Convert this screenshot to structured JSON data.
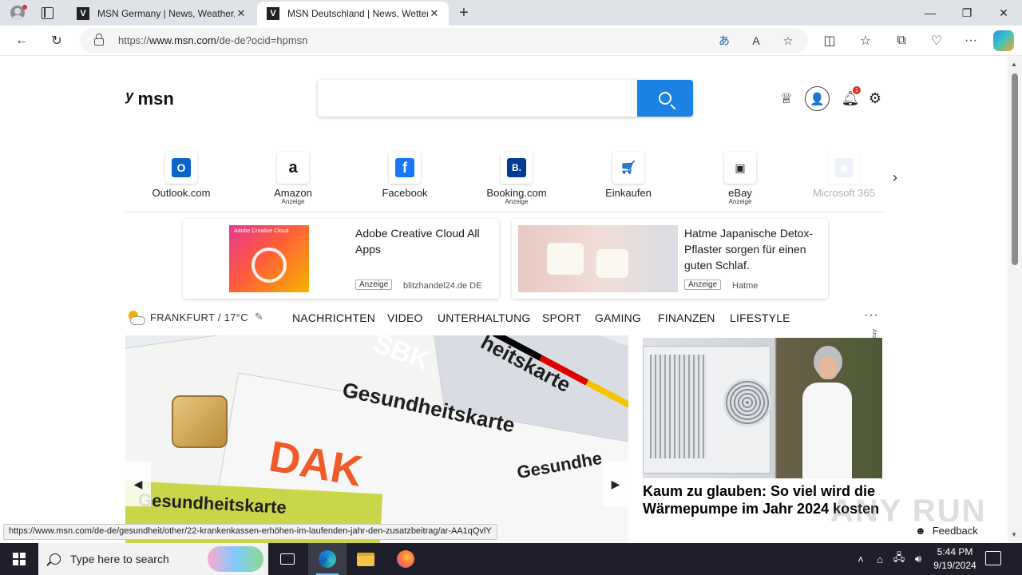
{
  "browser": {
    "tabs": [
      {
        "favicon": "msn-icon",
        "title": "MSN Germany | News, Weather,",
        "active": false
      },
      {
        "favicon": "msn-icon",
        "title": "MSN Deutschland | News, Wetter",
        "active": true
      }
    ],
    "new_tab_label": "+",
    "url_prefix": "https://",
    "url_domain": "www.msn.com",
    "url_path": "/de-de?ocid=hpmsn",
    "window_controls": {
      "minimize": "—",
      "maximize": "❐",
      "close": "✕"
    }
  },
  "page": {
    "logo_text": "msn",
    "search": {
      "placeholder": "",
      "value": ""
    },
    "notification_count": "1",
    "quick_links": [
      {
        "label": "Outlook.com",
        "sub": "",
        "icon": "outlook-icon",
        "color": "#0a64c8",
        "glyph": "O"
      },
      {
        "label": "Amazon",
        "sub": "Anzeige",
        "icon": "amazon-icon",
        "color": "#ffffff",
        "glyph": "a"
      },
      {
        "label": "Facebook",
        "sub": "",
        "icon": "facebook-icon",
        "color": "#1877f2",
        "glyph": "f"
      },
      {
        "label": "Booking.com",
        "sub": "Anzeige",
        "icon": "booking-icon",
        "color": "#003b95",
        "glyph": "B."
      },
      {
        "label": "Einkaufen",
        "sub": "",
        "icon": "shopping-cart-icon",
        "color": "#ffffff",
        "glyph": "🛒"
      },
      {
        "label": "eBay",
        "sub": "Anzeige",
        "icon": "ebay-icon",
        "color": "#ffffff",
        "glyph": "▣"
      },
      {
        "label": "Microsoft 365",
        "sub": "",
        "icon": "microsoft-365-icon",
        "color": "#cfd8e6",
        "glyph": "◉"
      }
    ],
    "ads": [
      {
        "title": "Adobe Creative Cloud All Apps",
        "badge": "Anzeige",
        "source": "blitzhandel24.de DE",
        "image_caption": "Adobe Creative Cloud"
      },
      {
        "title": "Hatme Japanische Detox-Pflaster sorgen für einen guten Schlaf.",
        "badge": "Anzeige",
        "source": "Hatme"
      }
    ],
    "weather": "FRANKFURT / 17°C",
    "nav": [
      "NACHRICHTEN",
      "VIDEO",
      "UNTERHALTUNG",
      "SPORT",
      "GAMING",
      "FINANZEN",
      "LIFESTYLE"
    ],
    "more_label": "···",
    "hero": {
      "card_words": [
        "SBK",
        "Gesundheitskarte",
        "heitskarte",
        "DAK",
        "Gesundhe",
        "Gesundheitskarte"
      ]
    },
    "side_story": {
      "title": "Kaum zu glauben: So viel wird die Wärmepumpe im Jahr 2024 kosten",
      "ad_label": "Anzeige"
    },
    "feedback_label": "Feedback",
    "watermark": "ANY RUN",
    "status_url": "https://www.msn.com/de-de/gesundheit/other/22-krankenkassen-erhöhen-im-laufenden-jahr-den-zusatzbeitrag/ar-AA1qQvlY"
  },
  "taskbar": {
    "search_placeholder": "Type here to search",
    "time": "5:44 PM",
    "date": "9/19/2024"
  }
}
